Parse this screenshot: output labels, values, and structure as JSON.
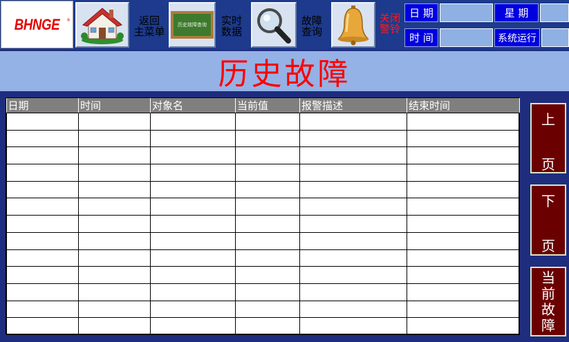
{
  "logo": {
    "text": "BHNGE",
    "mark": "®"
  },
  "toolbar": {
    "back_label_1": "返回",
    "back_label_2": "主菜单",
    "board_text": "历史故障查询",
    "realtime_label_1": "实时",
    "realtime_label_2": "数据",
    "query_label_1": "故障",
    "query_label_2": "查询",
    "bell_label_1": "关闭",
    "bell_label_2": "警铃"
  },
  "info": {
    "date_label": "日 期",
    "week_label": "星 期",
    "time_label": "时 间",
    "run_label": "系统运行",
    "date_value": "",
    "week_value": "",
    "time_value": "",
    "run_value": ""
  },
  "page_title": "历史故障",
  "table": {
    "columns": [
      "日期",
      "时间",
      "对象名",
      "当前值",
      "报警描述",
      "结束时间"
    ],
    "rows": 13
  },
  "side": {
    "prev_1": "上",
    "prev_2": "页",
    "next_1": "下",
    "next_2": "页",
    "current_1": "当",
    "current_2": "前",
    "current_3": "故",
    "current_4": "障"
  },
  "colors": {
    "background": "#1e2d7e",
    "title_band": "#94b2e6",
    "title_text": "#ff0000",
    "side_button": "#6b0000",
    "header_gray": "#7f7f7f",
    "info_label": "#0000e0"
  }
}
